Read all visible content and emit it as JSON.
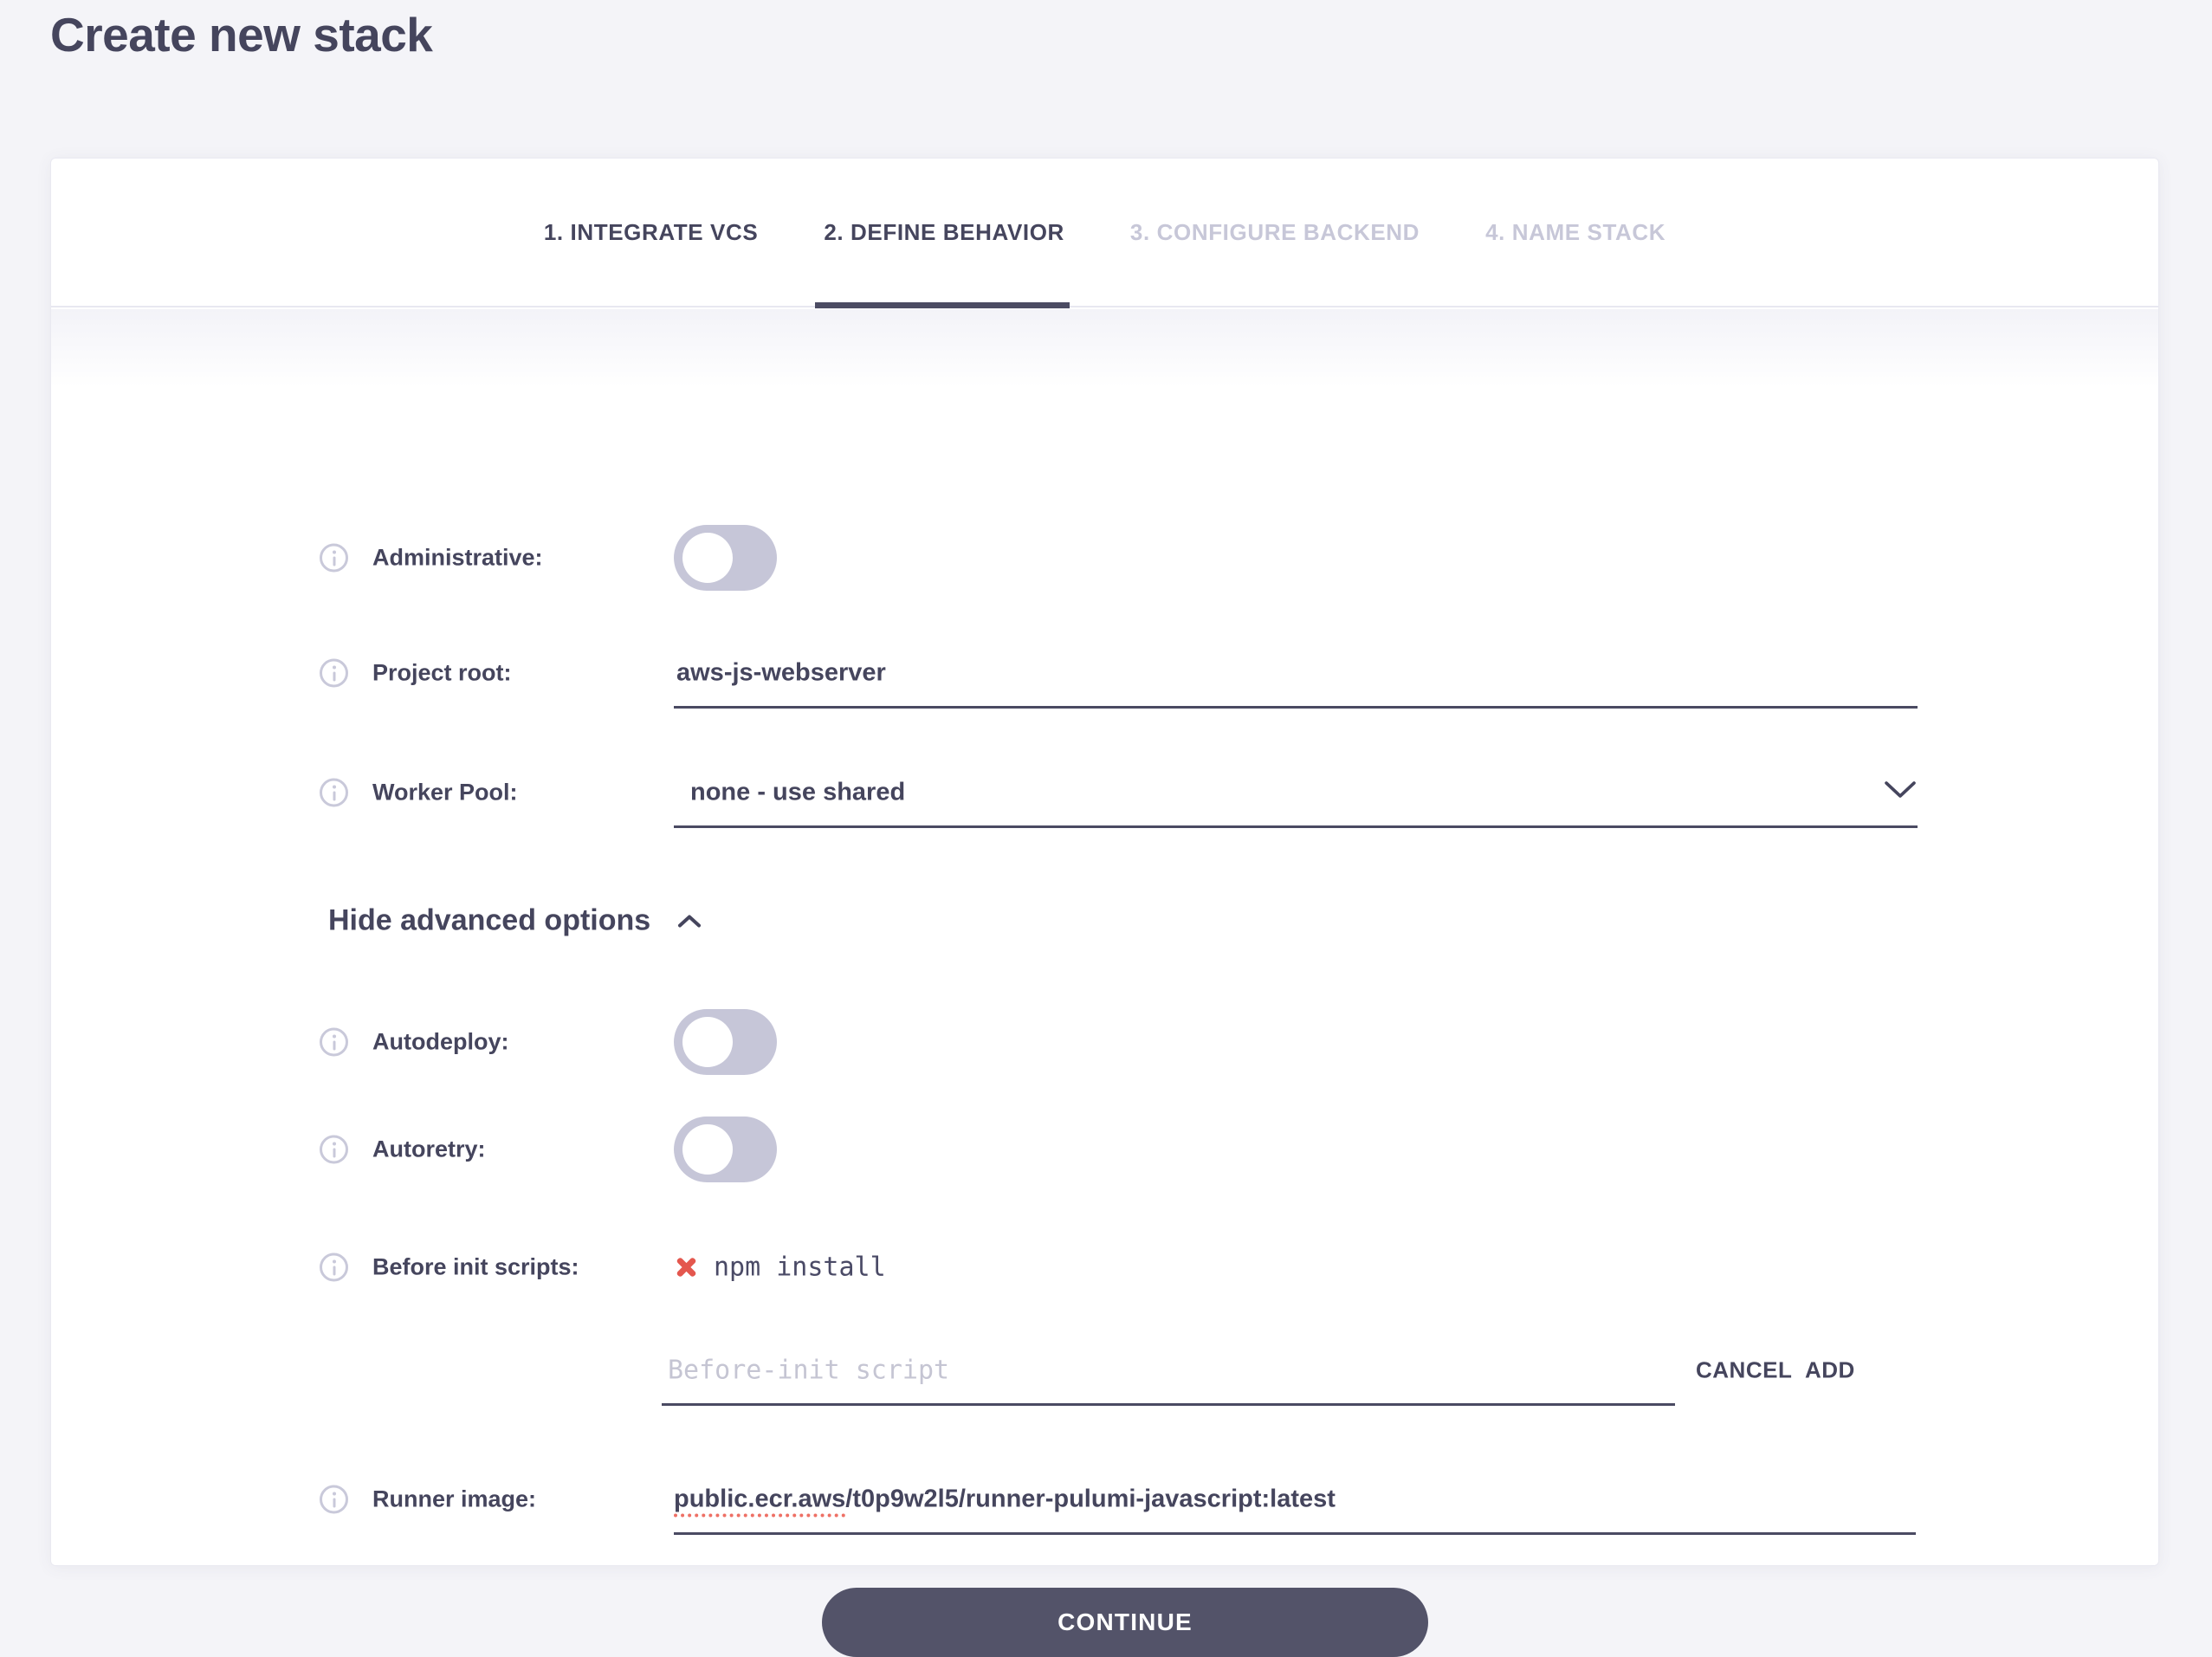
{
  "page": {
    "title": "Create new stack"
  },
  "tabs": [
    {
      "label": "1. INTEGRATE VCS",
      "state": "complete"
    },
    {
      "label": "2. DEFINE BEHAVIOR",
      "state": "active"
    },
    {
      "label": "3. CONFIGURE BACKEND",
      "state": "upcoming"
    },
    {
      "label": "4. NAME STACK",
      "state": "upcoming"
    }
  ],
  "form": {
    "administrative": {
      "label": "Administrative:",
      "enabled": false
    },
    "project_root": {
      "label": "Project root:",
      "value": "aws-js-webserver"
    },
    "worker_pool": {
      "label": "Worker Pool:",
      "selected": "none - use shared"
    },
    "advanced_options": {
      "toggle_label": "Hide advanced options",
      "expanded": true
    },
    "autodeploy": {
      "label": "Autodeploy:",
      "enabled": false
    },
    "autoretry": {
      "label": "Autoretry:",
      "enabled": false
    },
    "before_init_scripts": {
      "label": "Before init scripts:",
      "scripts": [
        {
          "command": "npm install"
        }
      ],
      "input": {
        "placeholder": "Before-init script",
        "value": ""
      },
      "cancel_label": "CANCEL",
      "add_label": "ADD"
    },
    "runner_image": {
      "label": "Runner image:",
      "value": "public.ecr.aws/t0p9w2l5/runner-pulumi-javascript:latest",
      "value_marked_part": "public.ecr.aws",
      "value_rest": "/t0p9w2l5/runner-pulumi-javascript:latest"
    }
  },
  "actions": {
    "continue_label": "CONTINUE"
  },
  "colors": {
    "text_dark": "#45455d",
    "text_muted": "#c7c7d8",
    "underline": "#4a4a62",
    "danger": "#e4574e",
    "toggle_track": "#c6c6d8",
    "button_bg": "#535369"
  }
}
